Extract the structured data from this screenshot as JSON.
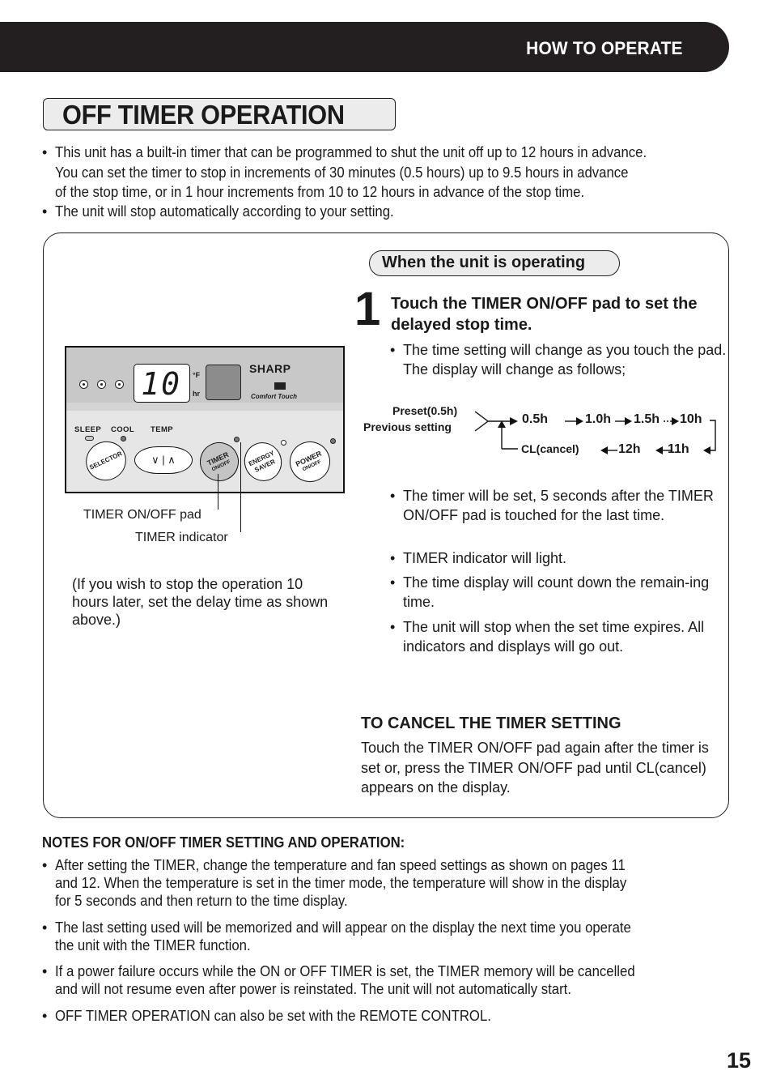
{
  "header": {
    "section": "HOW TO OPERATE"
  },
  "title": "OFF TIMER OPERATION",
  "intro": [
    [
      "This unit has a built-in timer that can be programmed to shut the unit off up to 12 hours in advance.",
      "You can set the timer to stop in increments of 30 minutes (0.5 hours) up to 9.5 hours in advance",
      "of the stop time, or in 1 hour increments from 10 to 12 hours in advance of the stop time."
    ],
    [
      "The unit will stop automatically according to your setting."
    ]
  ],
  "panel": {
    "condition": "When the unit is operating",
    "step_number": "1",
    "step_title": "Touch the TIMER ON/OFF pad to set the delayed stop time.",
    "step_bullet": "The time setting will change as you touch the pad. The display will change as follows;",
    "sequence": {
      "start_labels": [
        "Preset(0.5h)",
        "Previous setting"
      ],
      "forward": [
        "0.5h",
        "1.0h",
        "1.5h",
        "10h"
      ],
      "backward": [
        "11h",
        "12h",
        "CL(cancel)"
      ]
    },
    "after_bullets": [
      "The timer will be set, 5 seconds after the TIMER ON/OFF pad is touched for the last time.",
      "TIMER indicator will light.",
      "The time display will count down the remain-ing time.",
      "The unit will stop when the set time expires. All indicators and displays will go out."
    ],
    "left_note": "(If you wish to stop the operation 10 hours later, set the delay time as shown above.)",
    "control_panel": {
      "display_value": "10",
      "unit_f": "°F",
      "unit_hr": "hr",
      "brand": "SHARP",
      "brand_sub": "Comfort Touch",
      "labels": {
        "sleep": "SLEEP",
        "cool": "COOL",
        "temp": "TEMP"
      },
      "buttons": {
        "selector": "SELECTOR",
        "temp_symbols": "∨ | ∧",
        "timer": "TIMER",
        "timer_sub": "ON/OFF",
        "energy": "ENERGY",
        "energy_sub": "SAVER",
        "power": "POWER",
        "power_sub": "ON/OFF"
      }
    },
    "callouts": {
      "pad": "TIMER ON/OFF pad",
      "indicator": "TIMER indicator"
    },
    "cancel": {
      "heading": "TO CANCEL THE TIMER SETTING",
      "body": "Touch the TIMER ON/OFF pad again after the timer is set or, press the TIMER ON/OFF pad until CL(cancel) appears on the display."
    }
  },
  "notes": {
    "heading": "NOTES FOR ON/OFF TIMER SETTING AND OPERATION:",
    "items": [
      [
        "After setting the TIMER, change the temperature and fan speed settings as shown on pages 11",
        "and 12.  When the temperature is set in the timer mode, the temperature will show in the display",
        "for 5 seconds and then return to the time display."
      ],
      [
        "The last setting used will be memorized and will appear on the display the next time you operate",
        "the unit with the TIMER function."
      ],
      [
        "If a power failure occurs while the ON or OFF TIMER is set, the TIMER memory will be cancelled",
        "and will not resume even after power is reinstated.  The unit will not automatically start."
      ],
      [
        "OFF TIMER OPERATION can also be set with the REMOTE CONTROL."
      ]
    ]
  },
  "page_number": "15"
}
